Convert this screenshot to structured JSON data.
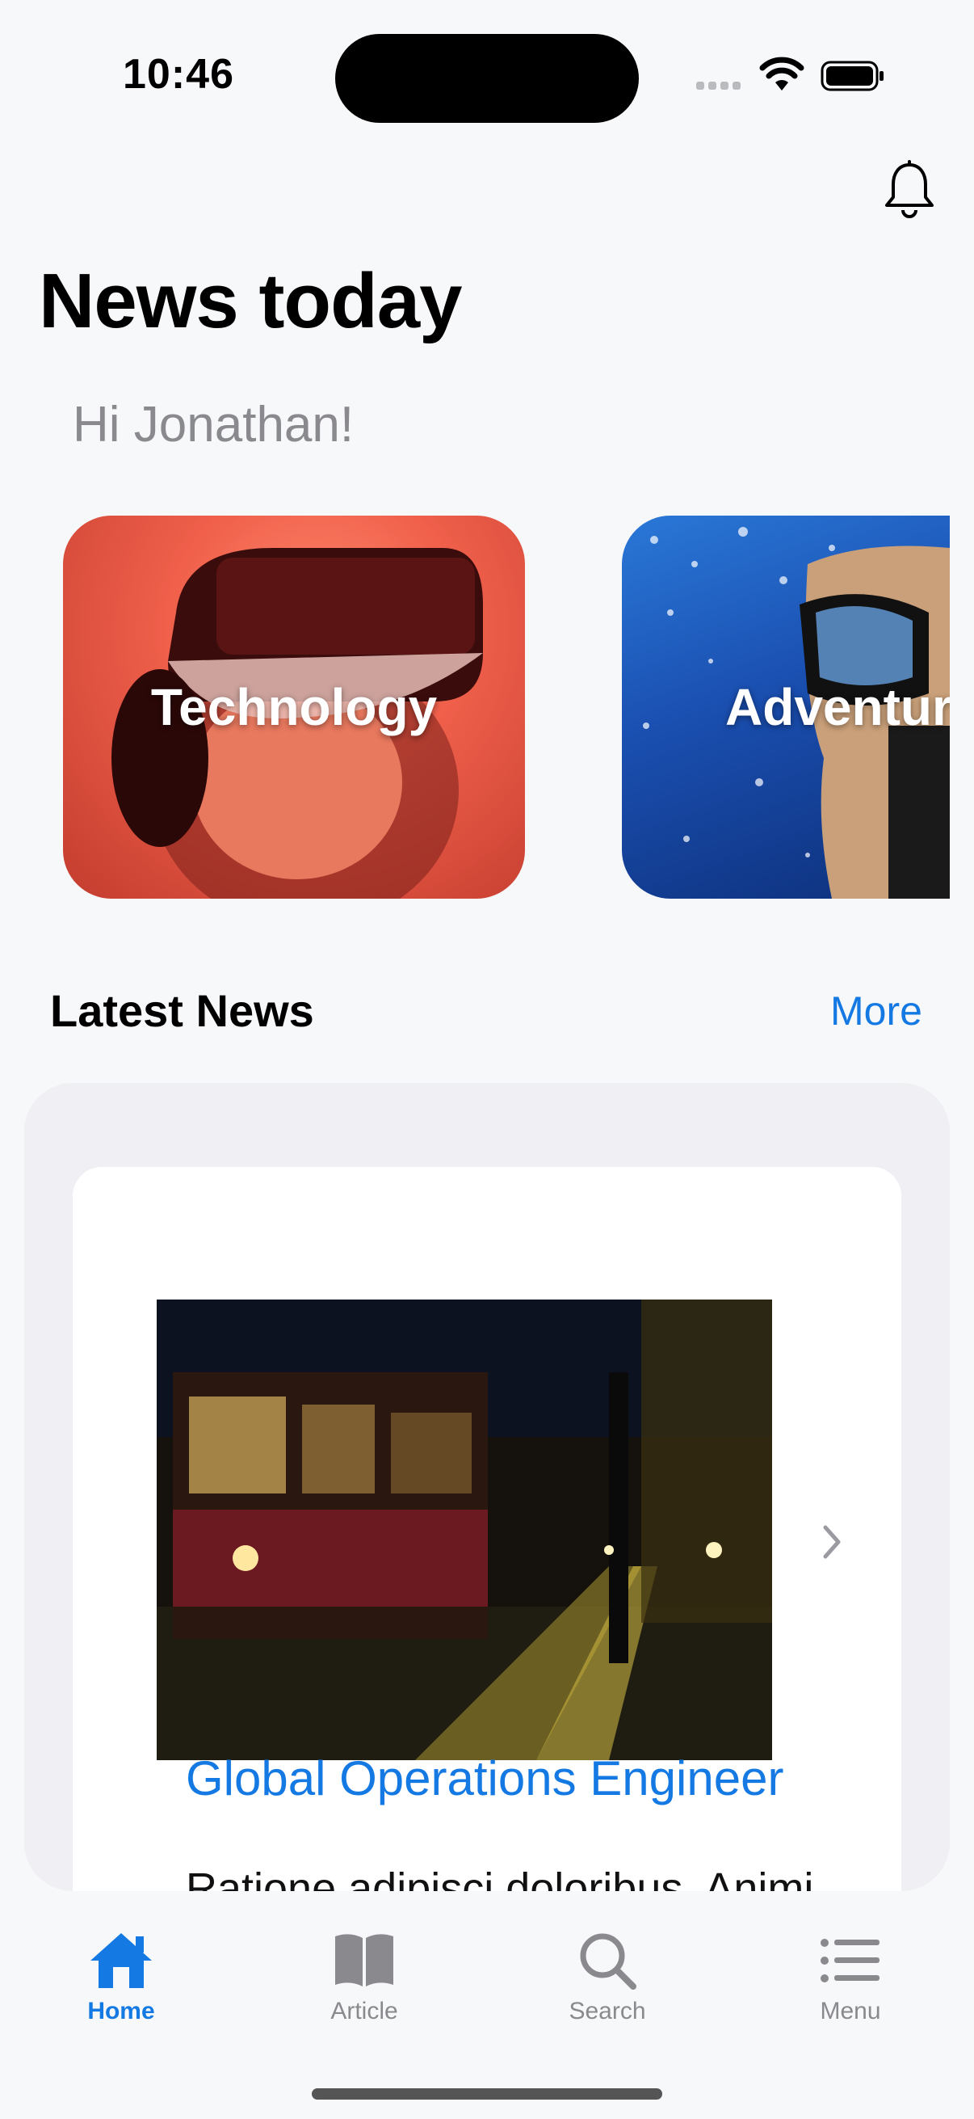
{
  "status_bar": {
    "time": "10:46"
  },
  "header": {
    "title": "News today",
    "greeting": "Hi Jonathan!",
    "bell_icon": "bell-icon"
  },
  "categories": [
    {
      "label": "Technology",
      "image": "vr-headset-photo"
    },
    {
      "label": "Adventure",
      "image": "diver-photo"
    }
  ],
  "latest": {
    "title": "Latest News",
    "more_label": "More",
    "article": {
      "title": "Global Operations Engineer",
      "excerpt": "Ratione adipisci doloribus. Animi",
      "image": "night-tram-street-photo"
    }
  },
  "tabs": [
    {
      "label": "Home",
      "icon": "house-icon",
      "active": true
    },
    {
      "label": "Article",
      "icon": "book-icon",
      "active": false
    },
    {
      "label": "Search",
      "icon": "magnifier-icon",
      "active": false
    },
    {
      "label": "Menu",
      "icon": "list-icon",
      "active": false
    }
  ],
  "colors": {
    "accent": "#1479e3",
    "inactive": "#8a8a8e",
    "background": "#f7f8fa"
  }
}
